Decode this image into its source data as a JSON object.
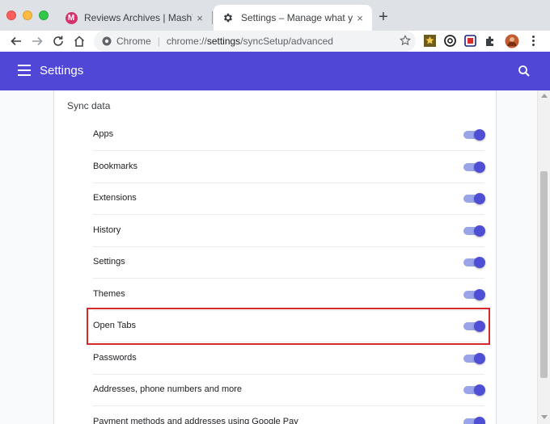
{
  "tabs": [
    {
      "title": "Reviews Archives | MashTips",
      "favicon": "mashtips-logo-icon",
      "favicon_letter": "M",
      "close": "×"
    },
    {
      "title": "Settings – Manage what you sync",
      "favicon": "gear-icon",
      "close": "×"
    }
  ],
  "new_tab_label": "+",
  "omnibox": {
    "site_label": "Chrome",
    "divider": "|",
    "url_scheme": "chrome://",
    "url_host": "settings",
    "url_path": "/syncSetup/advanced"
  },
  "appbar": {
    "title": "Settings",
    "color": "#5147d6"
  },
  "sync": {
    "section_title": "Sync data",
    "items": [
      {
        "label": "Apps",
        "on": true
      },
      {
        "label": "Bookmarks",
        "on": true
      },
      {
        "label": "Extensions",
        "on": true
      },
      {
        "label": "History",
        "on": true
      },
      {
        "label": "Settings",
        "on": true
      },
      {
        "label": "Themes",
        "on": true
      },
      {
        "label": "Open Tabs",
        "on": true
      },
      {
        "label": "Passwords",
        "on": true
      },
      {
        "label": "Addresses, phone numbers and more",
        "on": true
      },
      {
        "label": "Payment methods and addresses using Google Pay",
        "on": true
      }
    ]
  },
  "highlight_color": "#d52a2a"
}
